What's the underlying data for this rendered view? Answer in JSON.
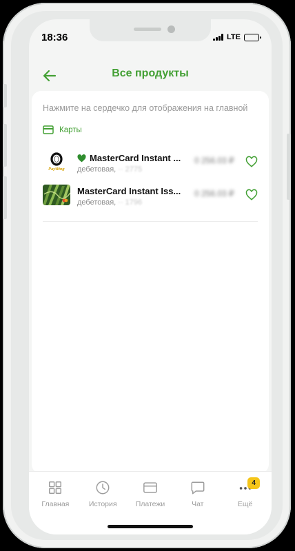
{
  "status_bar": {
    "time": "18:36",
    "network": "LTE",
    "battery_level": 0.8
  },
  "header": {
    "title": "Все продукты",
    "back_icon": "arrow-left-icon"
  },
  "hint_text": "Нажмите на сердечко для отображения на главной",
  "section": {
    "label": "Карты",
    "icon": "card-icon"
  },
  "cards": [
    {
      "name": "MasterCard Instant ...",
      "type": "дебетовая",
      "mask": " ·· 2775",
      "amount": "0 256.03 ₽",
      "on_main": true,
      "thumb": "paywing-logo"
    },
    {
      "name": "MasterCard Instant Iss...",
      "type": "дебетовая",
      "mask": " ·· 1796",
      "amount": "0 256.03 ₽",
      "on_main": false,
      "thumb": "green-card-art"
    }
  ],
  "tabs": [
    {
      "label": "Главная",
      "icon": "grid-icon"
    },
    {
      "label": "История",
      "icon": "clock-icon"
    },
    {
      "label": "Платежи",
      "icon": "card-icon"
    },
    {
      "label": "Чат",
      "icon": "chat-bubble-icon"
    },
    {
      "label": "Ещё",
      "icon": "more-dots-icon",
      "badge": "4"
    }
  ],
  "colors": {
    "accent": "#43a034",
    "accent_dark": "#2f8d2e",
    "badge": "#f5c518"
  }
}
